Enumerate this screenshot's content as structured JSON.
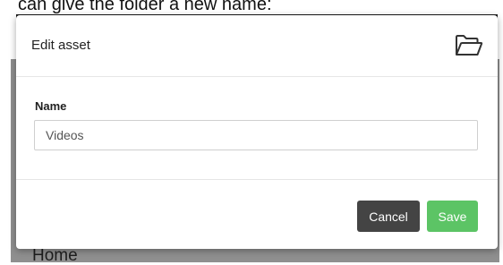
{
  "page": {
    "caption": "can give the folder a new name:",
    "background_label": "Home"
  },
  "modal": {
    "title": "Edit asset",
    "header_icon": "folder-open-icon",
    "name_label": "Name",
    "name_value": "Videos",
    "cancel_label": "Cancel",
    "save_label": "Save"
  },
  "colors": {
    "cancel_button": "#444444",
    "save_button": "#5cc465",
    "backdrop": "#8f8f8f"
  }
}
